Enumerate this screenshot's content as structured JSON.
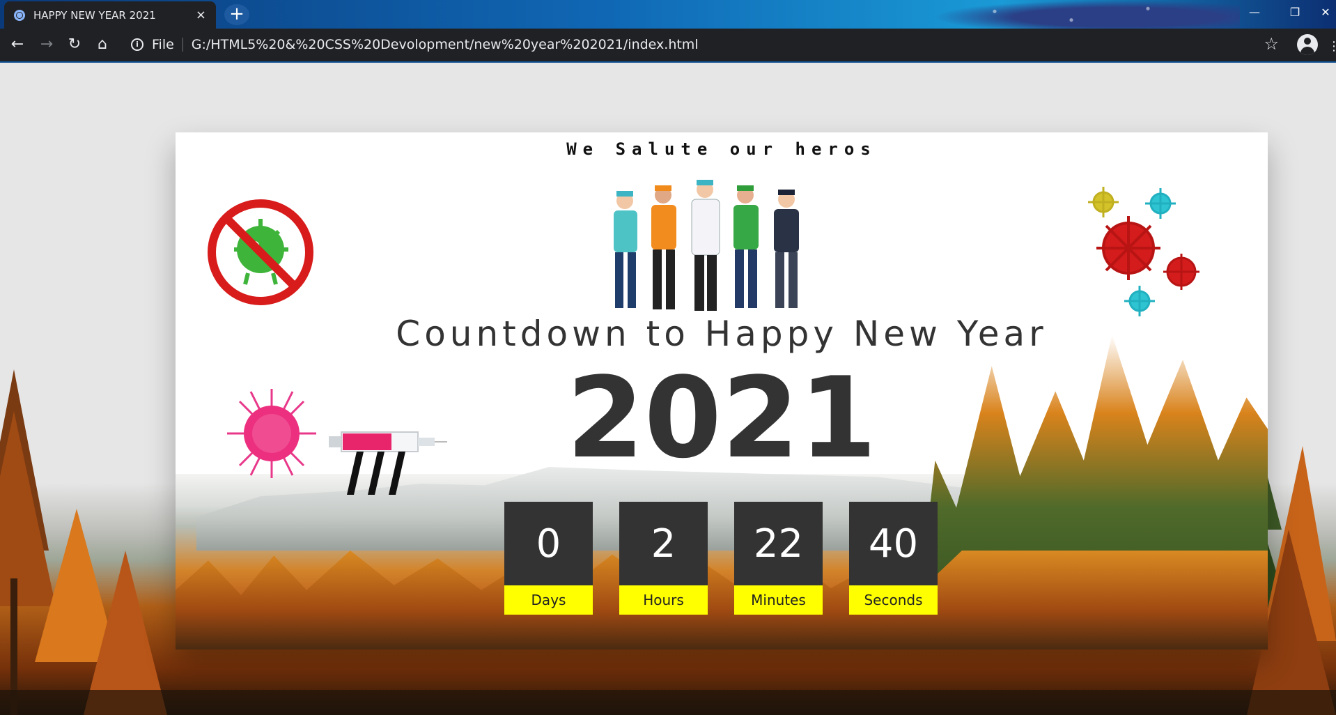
{
  "browser": {
    "tab_title": "HAPPY NEW YEAR 2021",
    "tab_close": "×",
    "new_tab": "+",
    "file_label": "File",
    "url": "G:/HTML5%20&%20CSS%20Devolopment/new%20year%202021/index.html",
    "window_controls": {
      "minimize": "—",
      "restore": "❐",
      "close": "✕"
    },
    "nav": {
      "back": "←",
      "forward": "→",
      "reload": "↻",
      "home": "⌂"
    },
    "star": "☆",
    "menu": "⋮",
    "info": "i"
  },
  "page": {
    "salute": "We Salute our heros",
    "countdown_title": "Countdown to Happy New Year",
    "year": "2021",
    "counters": [
      {
        "value": "0",
        "label": "Days"
      },
      {
        "value": "2",
        "label": "Hours"
      },
      {
        "value": "22",
        "label": "Minutes"
      },
      {
        "value": "40",
        "label": "Seconds"
      }
    ]
  },
  "colors": {
    "counter_bg": "#333333",
    "label_bg": "#ffff00",
    "tab_bg": "#202124"
  }
}
